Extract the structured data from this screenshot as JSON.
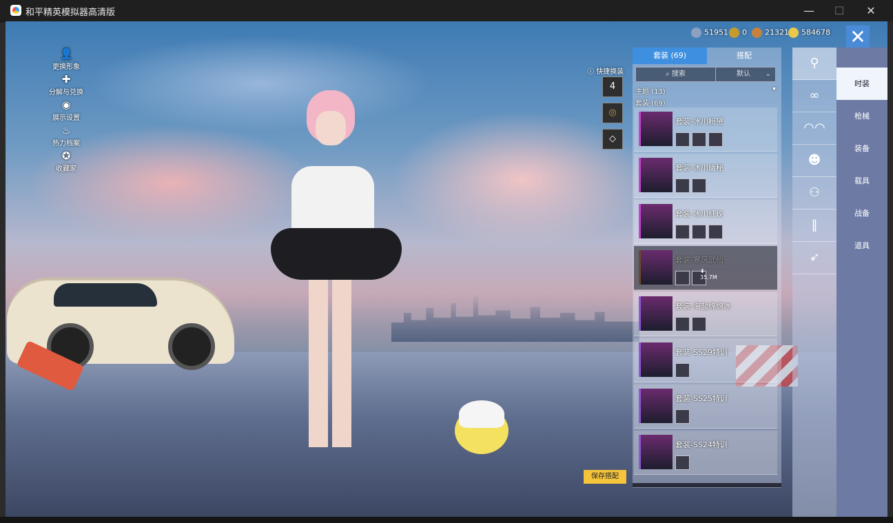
{
  "window": {
    "title": "和平精英模拟器高清版",
    "controls": {
      "minimize": "—",
      "maximize": "☐",
      "close": "✕"
    }
  },
  "left_menu": [
    {
      "label": "更换形象",
      "icon": "person-icon"
    },
    {
      "label": "分解与兑换",
      "icon": "puzzle-icon"
    },
    {
      "label": "展示设置",
      "icon": "eye-icon"
    },
    {
      "label": "热力档案",
      "icon": "flame-icon"
    },
    {
      "label": "收藏家",
      "icon": "medal-icon"
    }
  ],
  "currencies": [
    {
      "value": "51951",
      "color": "#8da0bf"
    },
    {
      "value": "0",
      "color": "#c79a2e"
    },
    {
      "value": "21321",
      "color": "#c8813a"
    },
    {
      "value": "584678",
      "color": "#e9c84a"
    }
  ],
  "quick_change": {
    "label": "快捷换装",
    "buttons": [
      "4",
      "",
      ""
    ]
  },
  "panel": {
    "tabs": [
      {
        "label": "套装 (69)",
        "active": true
      },
      {
        "label": "搭配",
        "active": false
      }
    ],
    "search_placeholder": "搜索",
    "sort": "默认",
    "theme_header": "主题 (13)",
    "suit_header": "套装 (69)",
    "items": [
      {
        "name": "套装-冰川粉黛",
        "accessories": 3,
        "dim": false
      },
      {
        "name": "套装-冰川幽秘",
        "accessories": 2,
        "dim": false
      },
      {
        "name": "套装-冰川红玫",
        "accessories": 3,
        "dim": false
      },
      {
        "name": "套装-寒风武仙",
        "accessories": 2,
        "dim": true,
        "download": "35.7M"
      },
      {
        "name": "套装-海盐绵绵冰",
        "accessories": 2,
        "dim": false
      },
      {
        "name": "套装-SS29特训",
        "accessories": 1,
        "dim": false
      },
      {
        "name": "套装-SS25特训",
        "accessories": 1,
        "dim": false
      },
      {
        "name": "套装-SS24特训",
        "accessories": 1,
        "dim": false
      }
    ],
    "save_button": "保存搭配"
  },
  "icon_column": [
    "hanger-icon",
    "goggles-icon",
    "glasses-icon",
    "mask-icon",
    "shirt-icon",
    "pants-icon",
    "shoes-icon"
  ],
  "categories": [
    {
      "label": "时装",
      "active": true
    },
    {
      "label": "枪械",
      "active": false
    },
    {
      "label": "装备",
      "active": false
    },
    {
      "label": "载具",
      "active": false
    },
    {
      "label": "战备",
      "active": false
    },
    {
      "label": "道具",
      "active": false
    }
  ]
}
